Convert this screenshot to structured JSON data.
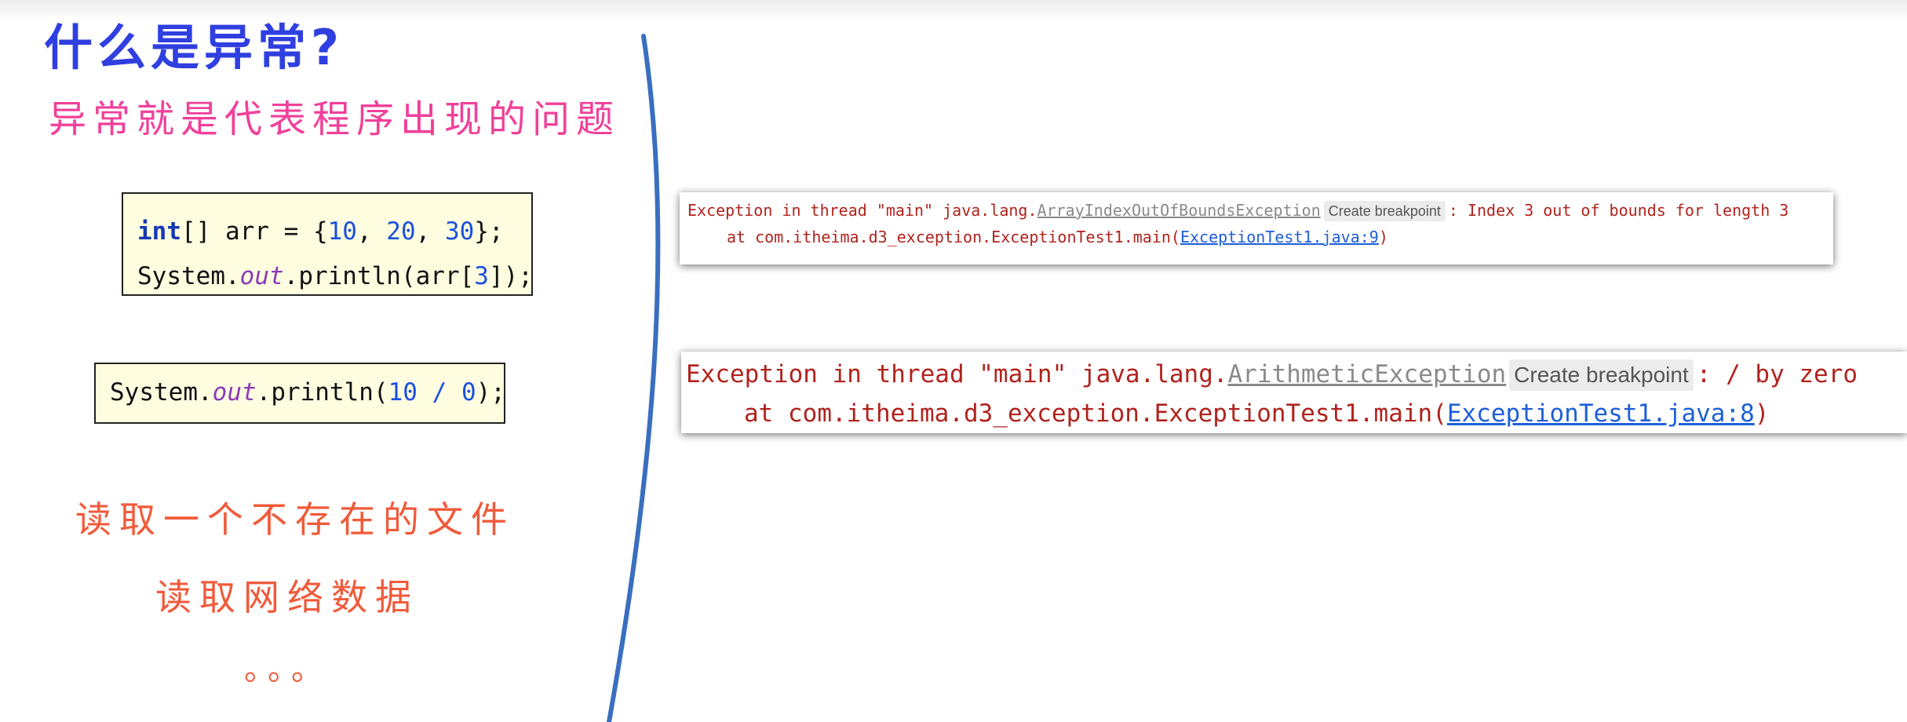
{
  "slide": {
    "title": "什么是异常?",
    "subtitle": "异常就是代表程序出现的问题",
    "code_box_1": {
      "line1": {
        "keyword": "int",
        "a": "[] arr = {",
        "n1": "10",
        "s1": ", ",
        "n2": "20",
        "s2": ", ",
        "n3": "30",
        "b": "};"
      },
      "line2": {
        "a": "System.",
        "field": "out",
        "b": ".println(arr[",
        "n": "3",
        "c": "]);"
      }
    },
    "code_box_2": {
      "a": "System.",
      "field": "out",
      "b": ".println(",
      "n1": "10",
      "op": " / ",
      "n2": "0",
      "c": ");"
    },
    "examples": [
      "读取一个不存在的文件",
      "读取网络数据",
      "。。。"
    ],
    "colors": {
      "title": "#2f3fe0",
      "subtitle": "#f0409a",
      "examples": "#f05a3a",
      "error_text": "#b0231d",
      "link": "#1e5fd8",
      "divider": "#3a6fbf"
    }
  },
  "console_1": {
    "prefix": "Exception in thread \"main\" java.lang.",
    "exception_class": "ArrayIndexOutOfBoundsException",
    "breakpoint_label": "Create breakpoint",
    "message": ": Index 3 out of bounds for length 3",
    "at_prefix": "at com.itheima.d3_exception.ExceptionTest1.main(",
    "link": "ExceptionTest1.java:9",
    "at_suffix": ")"
  },
  "console_2": {
    "prefix": "Exception in thread \"main\" java.lang.",
    "exception_class": "ArithmeticException",
    "breakpoint_label": "Create breakpoint",
    "message": ": / by zero",
    "at_prefix": "at com.itheima.d3_exception.ExceptionTest1.main(",
    "link": "ExceptionTest1.java:8",
    "at_suffix": ")"
  }
}
